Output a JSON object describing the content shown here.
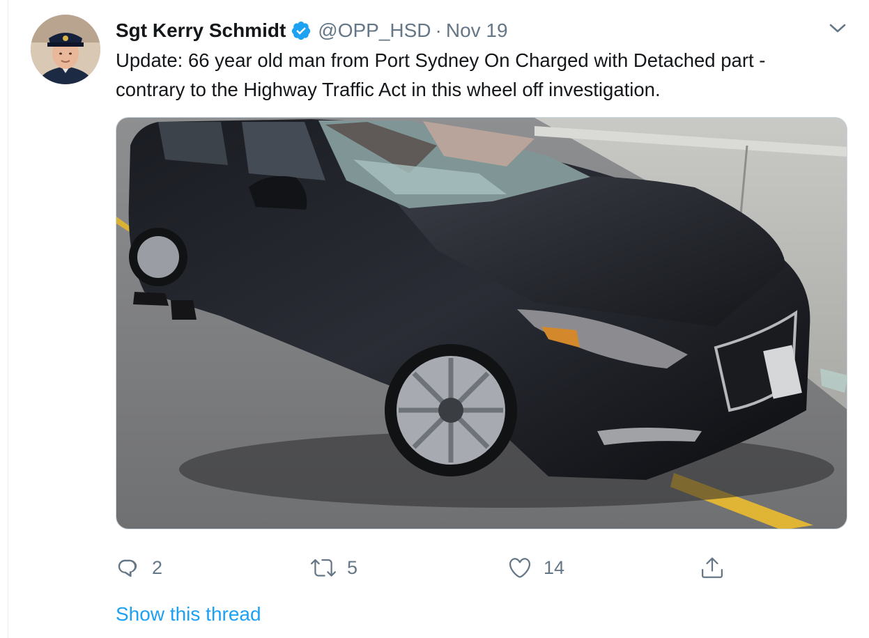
{
  "tweet": {
    "display_name": "Sgt Kerry Schmidt",
    "handle": "@OPP_HSD",
    "separator": "·",
    "date": "Nov 19",
    "text_lines": [
      "Update: 66 year old man from Port Sydney On Charged with Detached part -",
      "contrary to the Highway Traffic Act in this wheel off investigation."
    ],
    "verified": true
  },
  "actions": {
    "reply_count": "2",
    "retweet_count": "5",
    "like_count": "14"
  },
  "show_thread_label": "Show this thread",
  "icons": {
    "verified": "verified-badge-icon",
    "caret": "chevron-down-icon",
    "reply": "reply-icon",
    "retweet": "retweet-icon",
    "like": "heart-icon",
    "share": "share-icon"
  },
  "colors": {
    "accent": "#1da1f2",
    "secondary_text": "#657786",
    "primary_text": "#14171a"
  }
}
